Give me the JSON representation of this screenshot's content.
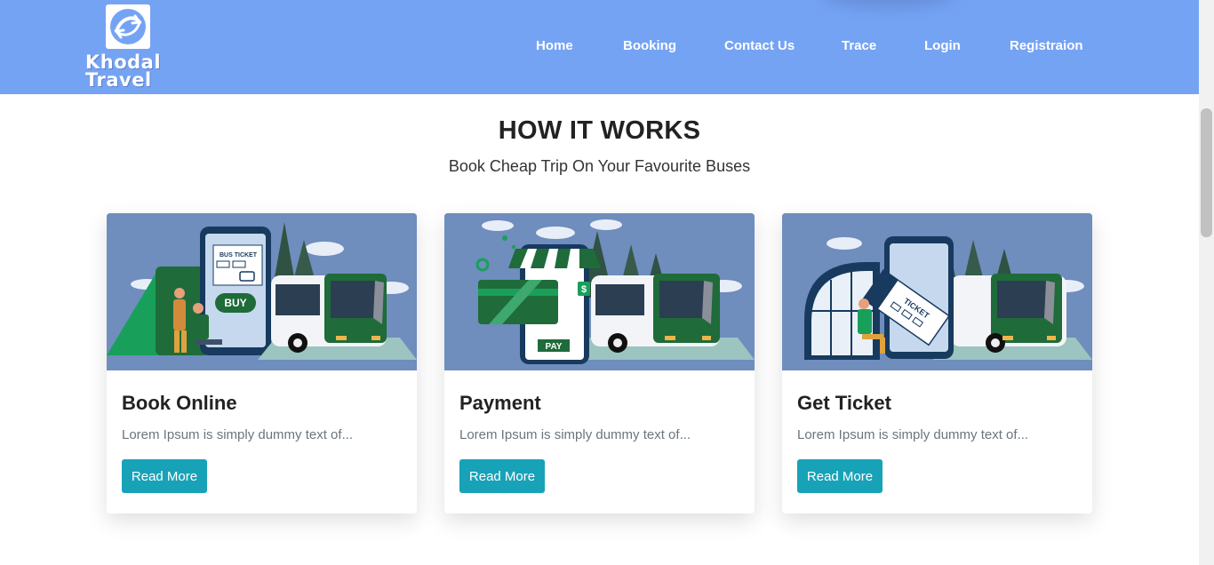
{
  "header": {
    "logo_line1": "Khodal",
    "logo_line2": "Travel",
    "nav": [
      "Home",
      "Booking",
      "Contact Us",
      "Trace",
      "Login",
      "Registraion"
    ]
  },
  "section": {
    "title": "HOW IT WORKS",
    "subtitle": "Book Cheap Trip On Your Favourite Buses"
  },
  "cards": [
    {
      "title": "Book Online",
      "text": "Lorem Ipsum is simply dummy text of...",
      "button": "Read More",
      "image_labels": [
        "BUS TICKET",
        "BUY"
      ]
    },
    {
      "title": "Payment",
      "text": "Lorem Ipsum is simply dummy text of...",
      "button": "Read More",
      "image_labels": [
        "PAY",
        "$"
      ]
    },
    {
      "title": "Get Ticket",
      "text": "Lorem Ipsum is simply dummy text of...",
      "button": "Read More",
      "image_labels": [
        "TICKET"
      ]
    }
  ],
  "colors": {
    "navbar": "#75a3f4",
    "button": "#17a2b8",
    "card_image_bg": "#6f8dbd",
    "bus_green": "#1f6b3a"
  }
}
